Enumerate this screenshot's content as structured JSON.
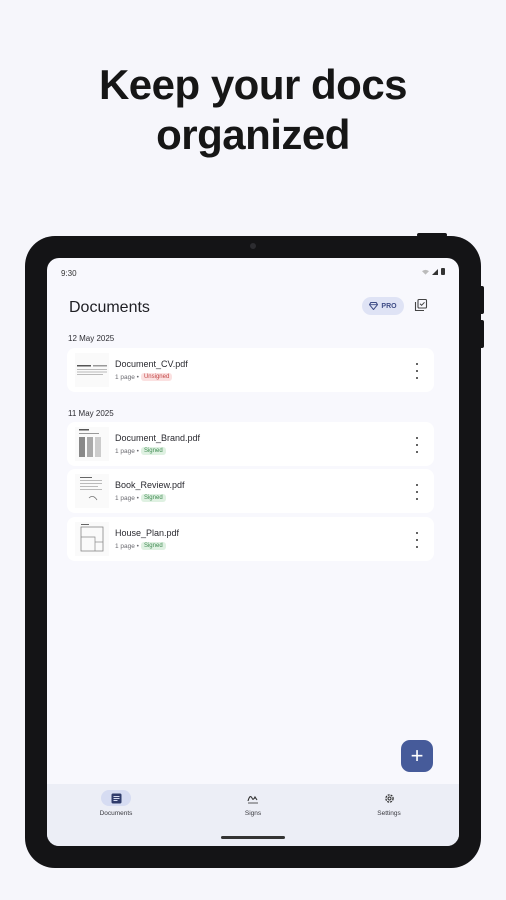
{
  "headline": {
    "line1": "Keep your docs",
    "line2": "organized"
  },
  "status": {
    "time": "9:30"
  },
  "appbar": {
    "title": "Documents",
    "pro_label": "PRO"
  },
  "groups": [
    {
      "date": "12 May 2025"
    },
    {
      "date": "11 May 2025"
    }
  ],
  "documents": [
    {
      "name": "Document_CV.pdf",
      "pages": "1 page •",
      "status": "Unsigned"
    },
    {
      "name": "Document_Brand.pdf",
      "pages": "1 page •",
      "status": "Signed"
    },
    {
      "name": "Book_Review.pdf",
      "pages": "1 page •",
      "status": "Signed"
    },
    {
      "name": "House_Plan.pdf",
      "pages": "1 page •",
      "status": "Signed"
    }
  ],
  "fab": {
    "label": "+"
  },
  "nav": {
    "items": [
      {
        "label": "Documents",
        "icon": "document-icon",
        "active": true
      },
      {
        "label": "Signs",
        "icon": "signature-icon",
        "active": false
      },
      {
        "label": "Settings",
        "icon": "gear-icon",
        "active": false
      }
    ]
  },
  "colors": {
    "accent": "#465b9a",
    "signed_bg": "#dff1e2",
    "unsigned_bg": "#fbe1e1"
  }
}
